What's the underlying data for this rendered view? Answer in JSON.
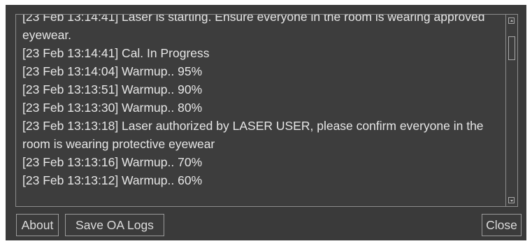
{
  "log": {
    "entries": [
      "[23 Feb 13:14:41] Laser is starting.  Ensure everyone in the room is wearing approved eyewear.",
      "[23 Feb 13:14:41] Cal. In Progress",
      "[23 Feb 13:14:04] Warmup.. 95%",
      "[23 Feb 13:13:51] Warmup.. 90%",
      "[23 Feb 13:13:30] Warmup.. 80%",
      "[23 Feb 13:13:18] Laser authorized by LASER USER, please confirm everyone in the room is wearing protective eyewear",
      "[23 Feb 13:13:16] Warmup.. 70%",
      "[23 Feb 13:13:12] Warmup.. 60%"
    ]
  },
  "buttons": {
    "about": "About",
    "save_logs": "Save OA Logs",
    "close": "Close"
  },
  "colors": {
    "panel_background": "#3a3a3a",
    "text": "#e6e6e6",
    "border": "#8c8c8c"
  }
}
